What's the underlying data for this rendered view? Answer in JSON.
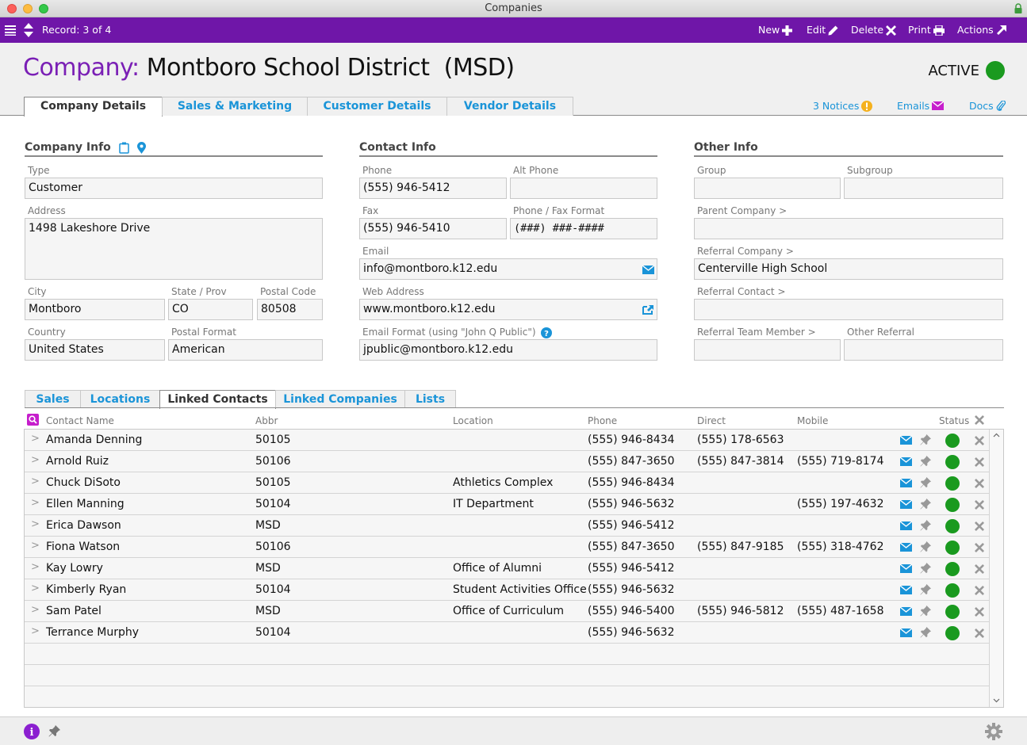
{
  "window": {
    "title": "Companies"
  },
  "toolbar": {
    "record_label": "Record: 3 of 4",
    "new_label": "New",
    "edit_label": "Edit",
    "delete_label": "Delete",
    "print_label": "Print",
    "actions_label": "Actions"
  },
  "header": {
    "title_label": "Company:",
    "title_value": "Montboro School District  (MSD)",
    "status_text": "ACTIVE",
    "status_color": "#1a9a1f",
    "tabs": [
      {
        "label": "Company Details",
        "active": true
      },
      {
        "label": "Sales & Marketing",
        "active": false
      },
      {
        "label": "Customer Details",
        "active": false
      },
      {
        "label": "Vendor Details",
        "active": false
      }
    ],
    "notices_label": "3 Notices",
    "emails_label": "Emails",
    "docs_label": "Docs"
  },
  "company_info": {
    "title": "Company Info",
    "type_label": "Type",
    "type_value": "Customer",
    "address_label": "Address",
    "address_value": "1498 Lakeshore Drive",
    "city_label": "City",
    "city_value": "Montboro",
    "state_label": "State / Prov",
    "state_value": "CO",
    "postal_label": "Postal Code",
    "postal_value": "80508",
    "country_label": "Country",
    "country_value": "United States",
    "postal_format_label": "Postal Format",
    "postal_format_value": "American"
  },
  "contact_info": {
    "title": "Contact Info",
    "phone_label": "Phone",
    "phone_value": "(555) 946-5412",
    "alt_phone_label": "Alt Phone",
    "alt_phone_value": "",
    "fax_label": "Fax",
    "fax_value": "(555) 946-5410",
    "phone_format_label": "Phone / Fax Format",
    "phone_format_value": "(###) ###-####",
    "email_label": "Email",
    "email_value": "info@montboro.k12.edu",
    "web_label": "Web Address",
    "web_value": "www.montboro.k12.edu",
    "email_format_label": "Email Format (using \"John Q Public\")",
    "email_format_value": "jpublic@montboro.k12.edu"
  },
  "other_info": {
    "title": "Other Info",
    "group_label": "Group",
    "group_value": "",
    "subgroup_label": "Subgroup",
    "subgroup_value": "",
    "parent_label": "Parent Company >",
    "parent_value": "",
    "ref_company_label": "Referral Company >",
    "ref_company_value": "Centerville High School",
    "ref_contact_label": "Referral Contact >",
    "ref_contact_value": "",
    "ref_team_label": "Referral Team Member >",
    "ref_team_value": "",
    "other_ref_label": "Other Referral",
    "other_ref_value": ""
  },
  "subtabs": [
    {
      "label": "Sales",
      "active": false
    },
    {
      "label": "Locations",
      "active": false
    },
    {
      "label": "Linked Contacts",
      "active": true
    },
    {
      "label": "Linked Companies",
      "active": false
    },
    {
      "label": "Lists",
      "active": false
    }
  ],
  "contacts_table": {
    "columns": [
      "Contact Name",
      "Abbr",
      "Location",
      "Phone",
      "Direct",
      "Mobile",
      "Status"
    ],
    "rows": [
      {
        "name": "Amanda Denning",
        "abbr": "50105",
        "location": "",
        "phone": "(555) 946-8434",
        "direct": "(555) 178-6563",
        "mobile": "",
        "status": "active"
      },
      {
        "name": "Arnold Ruiz",
        "abbr": "50106",
        "location": "",
        "phone": "(555) 847-3650",
        "direct": "(555) 847-3814",
        "mobile": "(555) 719-8174",
        "status": "active"
      },
      {
        "name": "Chuck DiSoto",
        "abbr": "50105",
        "location": "Athletics Complex",
        "phone": "(555) 946-8434",
        "direct": "",
        "mobile": "",
        "status": "active"
      },
      {
        "name": "Ellen Manning",
        "abbr": "50104",
        "location": "IT Department",
        "phone": "(555) 946-5632",
        "direct": "",
        "mobile": "(555) 197-4632",
        "status": "active"
      },
      {
        "name": "Erica Dawson",
        "abbr": "MSD",
        "location": "",
        "phone": "(555) 946-5412",
        "direct": "",
        "mobile": "",
        "status": "active"
      },
      {
        "name": "Fiona Watson",
        "abbr": "50106",
        "location": "",
        "phone": "(555) 847-3650",
        "direct": "(555) 847-9185",
        "mobile": "(555) 318-4762",
        "status": "active"
      },
      {
        "name": "Kay Lowry",
        "abbr": "MSD",
        "location": "Office of Alumni",
        "phone": "(555) 946-5412",
        "direct": "",
        "mobile": "",
        "status": "active"
      },
      {
        "name": "Kimberly Ryan",
        "abbr": "50104",
        "location": "Student Activities Office",
        "phone": "(555) 946-5632",
        "direct": "",
        "mobile": "",
        "status": "active"
      },
      {
        "name": "Sam Patel",
        "abbr": "MSD",
        "location": "Office of Curriculum",
        "phone": "(555) 946-5400",
        "direct": "(555) 946-5812",
        "mobile": "(555) 487-1658",
        "status": "active"
      },
      {
        "name": "Terrance Murphy",
        "abbr": "50104",
        "location": "",
        "phone": "(555) 946-5632",
        "direct": "",
        "mobile": "",
        "status": "active"
      }
    ]
  },
  "colors": {
    "brand": "#6f16a8",
    "link": "#1a94d8",
    "active": "#1a9a1f",
    "email_icon": "#1a94d8",
    "emails_header_icon": "#c61ecc"
  }
}
